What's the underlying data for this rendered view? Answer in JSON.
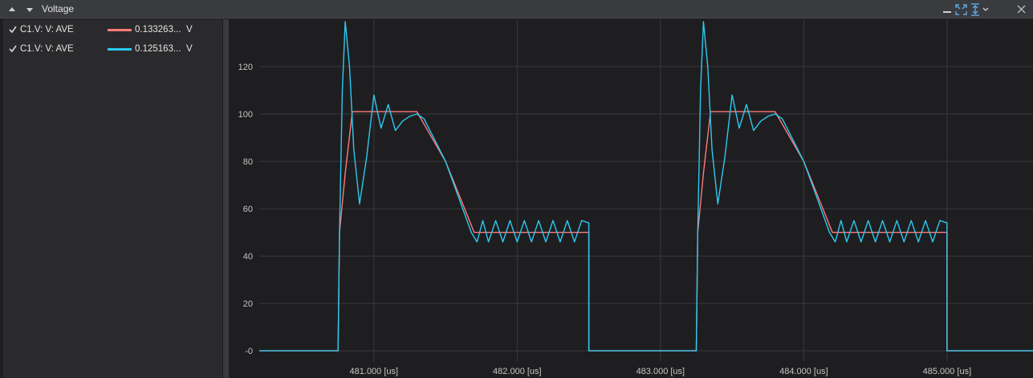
{
  "window": {
    "title": "Voltage",
    "collapse_up_icon": "triangle-up-icon",
    "collapse_down_icon": "triangle-down-icon",
    "buttons": [
      "minimize-icon",
      "fit-all-icon",
      "fit-vertical-icon",
      "dropdown-chevron-icon",
      "close-icon"
    ]
  },
  "legend": [
    {
      "checked": true,
      "name": "C1.V: V: AVE",
      "value": "0.133263...",
      "unit": "V",
      "color": "#ff7b7b"
    },
    {
      "checked": true,
      "name": "C1.V: V: AVE",
      "value": "0.125163...",
      "unit": "V",
      "color": "#2ec8f0"
    }
  ],
  "chart_data": {
    "type": "line",
    "title": "",
    "xlabel": "",
    "ylabel": "",
    "x_unit": "us",
    "xlim": [
      480.2,
      485.6
    ],
    "ylim": [
      -3,
      140
    ],
    "x_ticks": [
      481.0,
      482.0,
      483.0,
      484.0,
      485.0
    ],
    "x_tick_labels": [
      "481.000 [us]",
      "482.000 [us]",
      "483.000 [us]",
      "484.000 [us]",
      "485.000 [us]"
    ],
    "y_ticks": [
      0,
      20,
      40,
      60,
      80,
      100,
      120
    ],
    "y_tick_labels": [
      "-0",
      "20",
      "40",
      "60",
      "80",
      "100",
      "120"
    ],
    "grid": true,
    "background": "#1e1e20",
    "series": [
      {
        "name": "C1.V: V: AVE",
        "color": "#ff7b7b",
        "x": [
          480.2,
          480.75,
          480.76,
          480.8,
          480.85,
          481.3,
          481.5,
          481.7,
          482.5,
          482.5,
          483.25,
          483.26,
          483.3,
          483.35,
          483.8,
          484.0,
          484.2,
          485.0,
          485.0,
          485.6
        ],
        "y": [
          0,
          0,
          50,
          75,
          101,
          101,
          80,
          50,
          50,
          0,
          0,
          50,
          75,
          101,
          101,
          80,
          50,
          50,
          0,
          0
        ]
      },
      {
        "name": "C1.V: V: AVE",
        "color": "#2ec8f0",
        "x": [
          480.2,
          480.75,
          480.76,
          480.78,
          480.8,
          480.83,
          480.86,
          480.9,
          480.95,
          481.0,
          481.05,
          481.1,
          481.15,
          481.2,
          481.25,
          481.3,
          481.35,
          481.5,
          481.68,
          481.72,
          481.76,
          481.8,
          481.85,
          481.9,
          481.95,
          482.0,
          482.05,
          482.1,
          482.15,
          482.2,
          482.25,
          482.3,
          482.35,
          482.4,
          482.45,
          482.5,
          482.5,
          483.25,
          483.26,
          483.28,
          483.3,
          483.33,
          483.36,
          483.4,
          483.45,
          483.5,
          483.55,
          483.6,
          483.65,
          483.7,
          483.75,
          483.8,
          483.85,
          484.0,
          484.18,
          484.22,
          484.26,
          484.3,
          484.35,
          484.4,
          484.45,
          484.5,
          484.55,
          484.6,
          484.65,
          484.7,
          484.75,
          484.8,
          484.85,
          484.9,
          484.95,
          485.0,
          485.0,
          485.6
        ],
        "y": [
          0,
          0,
          50,
          110,
          139,
          120,
          85,
          62,
          82,
          108,
          94,
          104,
          93,
          97,
          99,
          100,
          98,
          80,
          50,
          46,
          55,
          46,
          55,
          46,
          55,
          46,
          55,
          46,
          55,
          46,
          55,
          46,
          55,
          46,
          55,
          54,
          0,
          0,
          50,
          110,
          139,
          120,
          85,
          62,
          82,
          108,
          94,
          104,
          93,
          97,
          99,
          100,
          98,
          80,
          50,
          46,
          55,
          46,
          55,
          46,
          55,
          46,
          55,
          46,
          55,
          46,
          55,
          46,
          55,
          46,
          55,
          54,
          0,
          0
        ]
      }
    ]
  }
}
